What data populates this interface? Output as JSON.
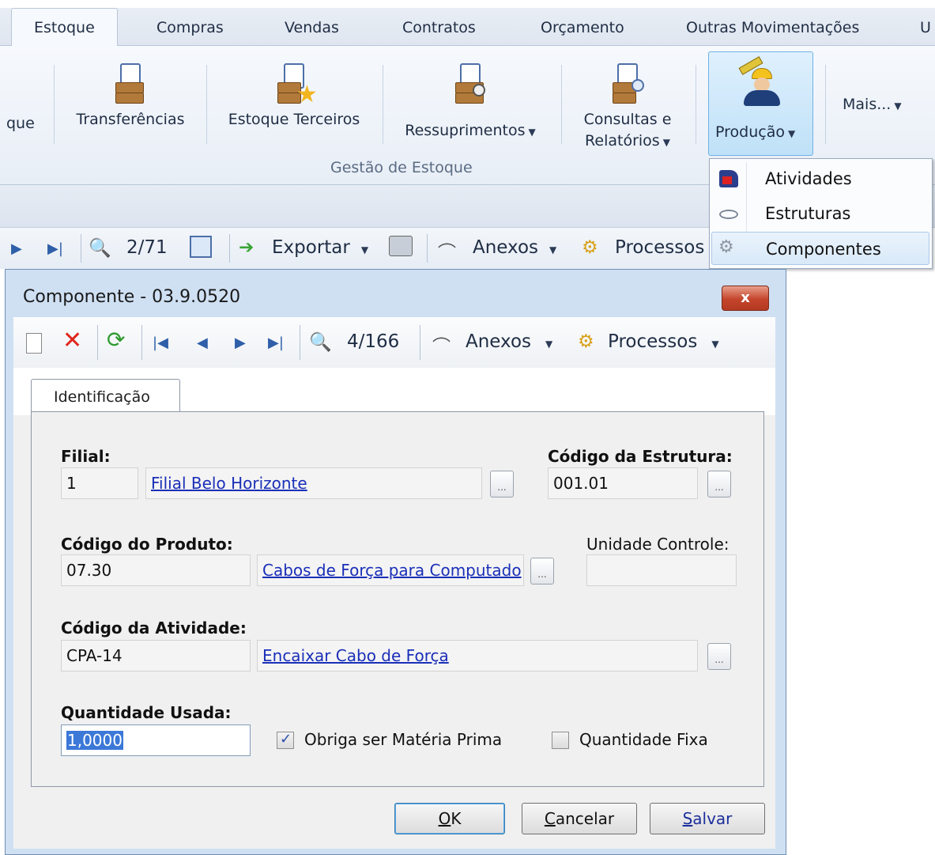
{
  "ribbon": {
    "tabs": [
      {
        "label": "Estoque",
        "active": true
      },
      {
        "label": "Compras"
      },
      {
        "label": "Vendas"
      },
      {
        "label": "Contratos"
      },
      {
        "label": "Orçamento"
      },
      {
        "label": "Outras Movimentações"
      },
      {
        "label": "U"
      }
    ],
    "buttons": {
      "estoque_partial": "que",
      "transferencias": "Transferências",
      "estoque_terceiros": "Estoque Terceiros",
      "ressuprimentos": "Ressuprimentos",
      "consultas_line1": "Consultas e",
      "consultas_line2": "Relatórios",
      "producao": "Produção",
      "mais": "Mais..."
    },
    "group_label": "Gestão de Estoque",
    "producao_menu": [
      {
        "label": "Atividades",
        "icon": "activities-icon"
      },
      {
        "label": "Estruturas",
        "icon": "structures-icon"
      },
      {
        "label": "Componentes",
        "icon": "components-icon",
        "highlighted": true
      }
    ]
  },
  "back_toolbar": {
    "record_counter": "2/71",
    "exportar": "Exportar",
    "anexos": "Anexos",
    "processos": "Processos"
  },
  "dialog": {
    "title": "Componente - 03.9.0520",
    "close_label": "x",
    "toolbar": {
      "record_counter": "4/166",
      "anexos": "Anexos",
      "processos": "Processos"
    },
    "tab": "Identificação",
    "fields": {
      "filial_label": "Filial:",
      "filial_code": "1",
      "filial_name": "Filial Belo Horizonte",
      "estrutura_label": "Código da Estrutura:",
      "estrutura_code": "001.01",
      "produto_label": "Código do Produto:",
      "produto_code": "07.30",
      "produto_name": "Cabos de Força para Computado",
      "unidade_label": "Unidade Controle:",
      "unidade_value": "",
      "atividade_label": "Código da Atividade:",
      "atividade_code": "CPA-14",
      "atividade_name": "Encaixar Cabo de Força",
      "quantidade_label": "Quantidade Usada:",
      "quantidade_value": "1,0000",
      "materia_prima_label": "Obriga ser Matéria Prima",
      "materia_prima_checked": true,
      "quantidade_fixa_label": "Quantidade Fixa",
      "quantidade_fixa_checked": false,
      "ellipsis": "..."
    },
    "buttons": {
      "ok_hot": "O",
      "ok_rest": "K",
      "cancelar_hot": "C",
      "cancelar_rest": "ancelar",
      "salvar_hot": "S",
      "salvar_rest": "alvar"
    }
  },
  "colors": {
    "accent_blue": "#6fb1e6",
    "link": "#1a2fb8",
    "close_red": "#c4442b",
    "selection": "#3b78d8"
  }
}
